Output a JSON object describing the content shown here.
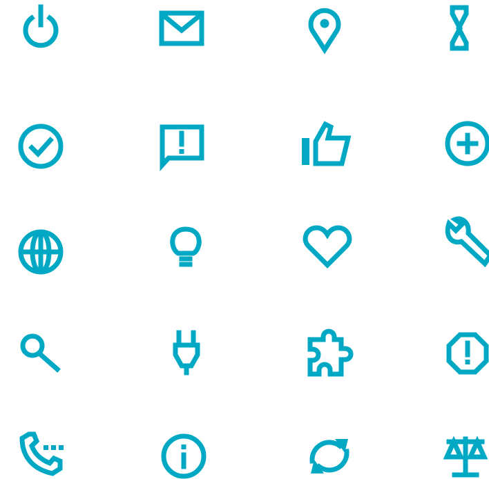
{
  "theme": {
    "accent": "#00A8C4",
    "background": "#FFFFFF"
  },
  "icons": [
    [
      "power-icon",
      "envelope-icon",
      "map-pin-icon",
      "hourglass-icon"
    ],
    [
      "check-circle-icon",
      "comment-alert-icon",
      "thumbs-up-icon",
      "plus-circle-icon"
    ],
    [
      "globe-icon",
      "lightbulb-icon",
      "heart-icon",
      "wrench-icon"
    ],
    [
      "search-icon",
      "plug-icon",
      "puzzle-piece-icon",
      "alert-octagon-icon"
    ],
    [
      "phone-dots-icon",
      "info-circle-icon",
      "refresh-icon",
      "scale-icon"
    ]
  ]
}
